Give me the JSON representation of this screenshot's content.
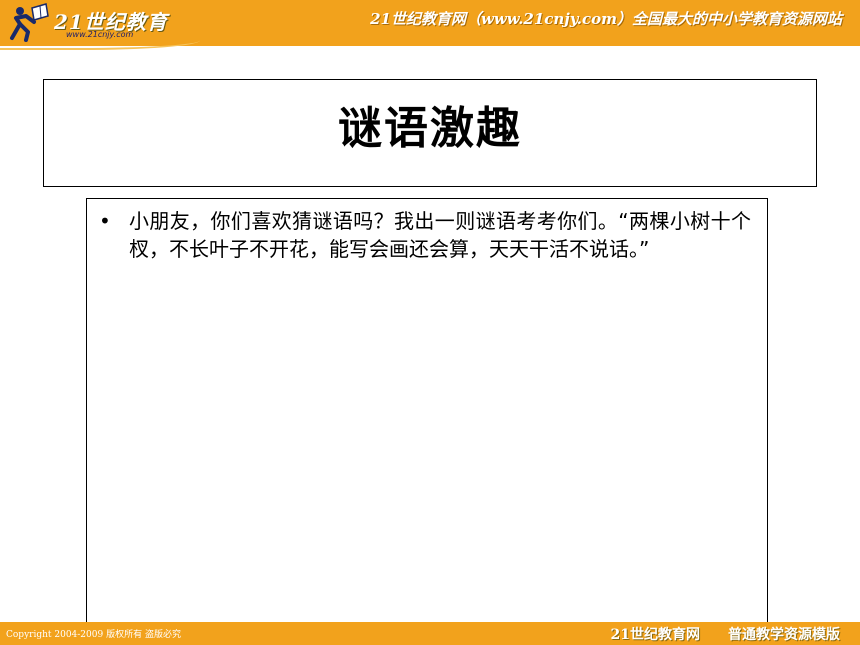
{
  "header": {
    "logo_text": "21世纪教育",
    "logo_url": "www.21cnjy.com",
    "slogan": "21世纪教育网（www.21cnjy.com）全国最大的中小学教育资源网站"
  },
  "slide": {
    "title": "谜语激趣",
    "bullets": [
      "小朋友，你们喜欢猜谜语吗？我出一则谜语考考你们。“两棵小树十个杈，不长叶子不开花，能写会画还会算，天天干活不说话。”"
    ]
  },
  "footer": {
    "copyright": "Copyright 2004-2009 版权所有 盗版必究",
    "brand": "21世纪教育网",
    "template": "普通教学资源模版"
  },
  "colors": {
    "banner": "#f2a21c",
    "text": "#000000",
    "background": "#ffffff"
  },
  "icons": {
    "logo": "running-figure-book-logo-icon"
  }
}
